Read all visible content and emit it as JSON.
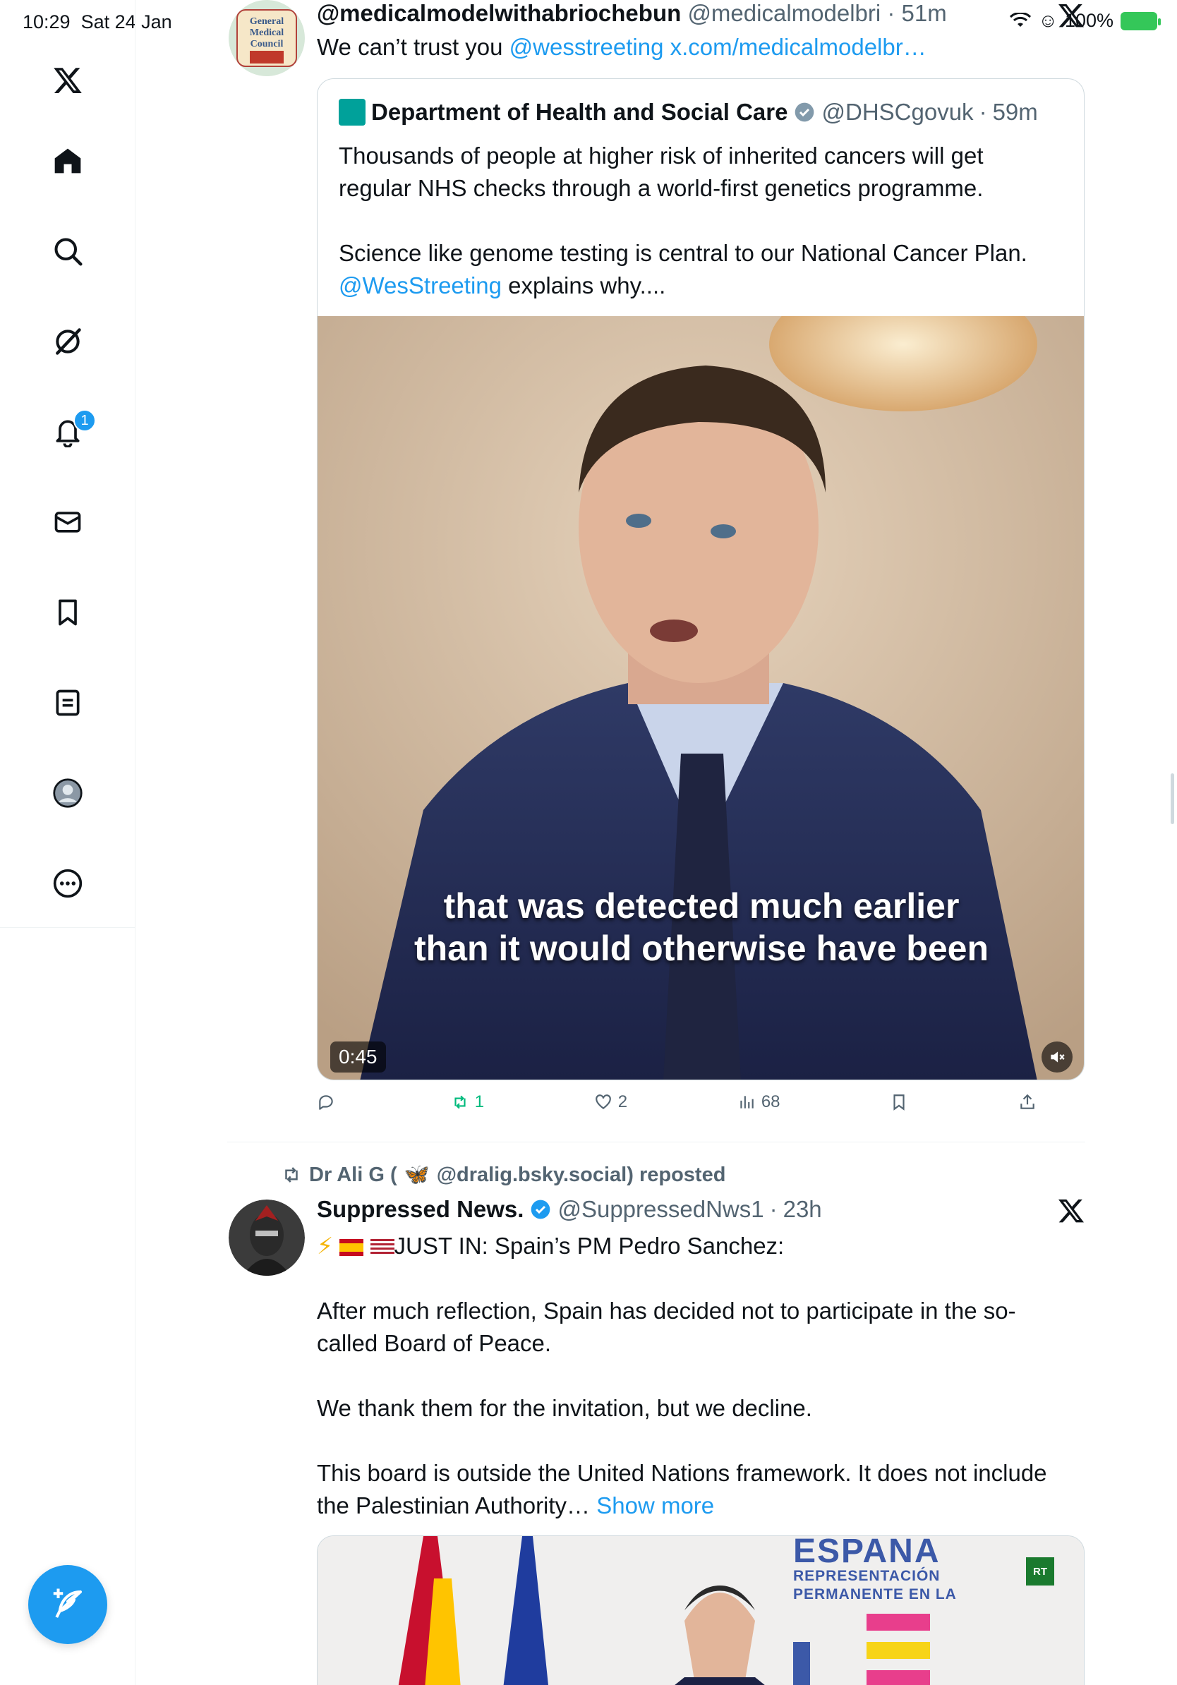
{
  "status": {
    "time": "10:29",
    "date": "Sat 24 Jan",
    "battery": "100%"
  },
  "sidebar": {
    "items": [
      {
        "name": "x-logo"
      },
      {
        "name": "home"
      },
      {
        "name": "search"
      },
      {
        "name": "grok"
      },
      {
        "name": "notifications",
        "badge": "1"
      },
      {
        "name": "messages"
      },
      {
        "name": "bookmarks"
      },
      {
        "name": "lists"
      },
      {
        "name": "profile"
      },
      {
        "name": "more"
      }
    ]
  },
  "tweet1": {
    "name": "@medicalmodelwithabriochebun",
    "handle": "@medicalmodelbri",
    "time": "51m",
    "text_plain": "We can’t trust you ",
    "mention": "@wesstreeting",
    "link": "x.com/medicalmodelbr…",
    "avatar_text": [
      "General",
      "Medical",
      "Council"
    ],
    "quote": {
      "name": "Department of Health and Social Care",
      "handle": "@DHSCgovuk",
      "time": "59m",
      "text_line1": "Thousands of people at higher risk of inherited cancers will get",
      "text_line2": "regular NHS checks through a world-first genetics programme.",
      "text_line3": "Science like genome testing is central to our National Cancer Plan.",
      "mention": "@WesStreeting",
      "text_end": " explains why....",
      "video_caption_line1": "that was detected much earlier",
      "video_caption_line2": "than it would otherwise have been",
      "duration": "0:45"
    },
    "actions": {
      "reply": "",
      "repost": "1",
      "like": "2",
      "views": "68"
    }
  },
  "tweet2": {
    "repost_by": "Dr Ali G (",
    "repost_handle": "@dralig.bsky.social) reposted",
    "name": "Suppressed News.",
    "handle": "@SuppressedNws1",
    "time": "23h",
    "line1": "JUST IN: Spain’s PM Pedro Sanchez:",
    "line2": "After much reflection, Spain has decided not to participate in the so-",
    "line3": "called Board of Peace.",
    "line4": "We thank them for the invitation, but we decline.",
    "line5": "This board is outside the United Nations framework. It does not include",
    "line6": "the Palestinian Authority… ",
    "show_more": "Show more",
    "media_title": "ESPANA",
    "media_sub1": "REPRESENTACIÓN",
    "media_sub2": "PERMANENTE EN LA",
    "media_logo": "RT"
  },
  "colors": {
    "accent": "#1d9bf0",
    "text": "#0f1419",
    "secondary": "#536471",
    "repost_green": "#00ba7c"
  }
}
